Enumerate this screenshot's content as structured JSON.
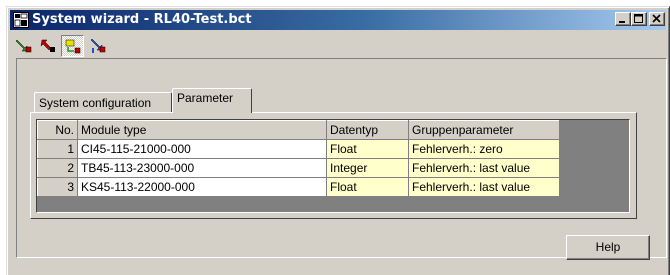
{
  "window": {
    "title": "System wizard - RL40-Test.bct",
    "controls": [
      "minimize-icon",
      "maximize-icon",
      "close-icon"
    ]
  },
  "toolbar": {
    "buttons": [
      {
        "icon": "arrow-down-right-icon",
        "pressed": false
      },
      {
        "icon": "arrow-up-left-icon",
        "pressed": false
      },
      {
        "icon": "module-config-icon",
        "pressed": true
      },
      {
        "icon": "info-arrow-icon",
        "pressed": false
      }
    ]
  },
  "tabs": [
    {
      "label": "System configuration",
      "active": false
    },
    {
      "label": "Parameter",
      "active": true
    }
  ],
  "table": {
    "columns": [
      "No.",
      "Module type",
      "Datentyp",
      "Gruppenparameter"
    ],
    "rows": [
      {
        "no": "1",
        "module": "CI45-115-21000-000",
        "type": "Float",
        "group": "Fehlerverh.: zero"
      },
      {
        "no": "2",
        "module": "TB45-113-23000-000",
        "type": "Integer",
        "group": "Fehlerverh.: last value"
      },
      {
        "no": "3",
        "module": "KS45-113-22000-000",
        "type": "Float",
        "group": "Fehlerverh.: last value"
      }
    ]
  },
  "buttons": {
    "help": "Help"
  },
  "colors": {
    "title_gradient_start": "#0a246a",
    "title_gradient_end": "#a6caf0",
    "window_face": "#d4d0c8",
    "editable_cell": "#ffffcc",
    "grid_background": "#808080"
  }
}
